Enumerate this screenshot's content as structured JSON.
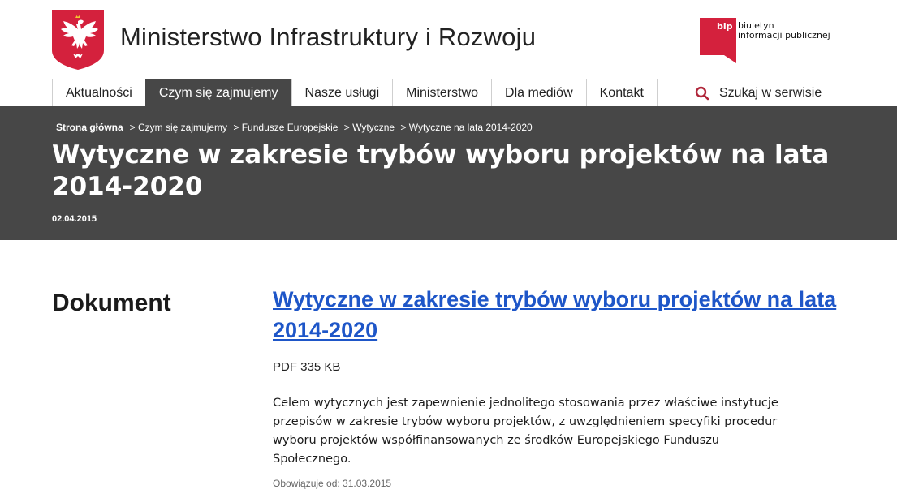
{
  "header": {
    "site_title": "Ministerstwo Infrastruktury i Rozwoju",
    "bip_line1": "biuletyn",
    "bip_line2": "informacji publicznej",
    "bip_logo_text": "bip"
  },
  "nav": {
    "items": [
      {
        "label": "Aktualności",
        "active": false
      },
      {
        "label": "Czym się zajmujemy",
        "active": true
      },
      {
        "label": "Nasze usługi",
        "active": false
      },
      {
        "label": "Ministerstwo",
        "active": false
      },
      {
        "label": "Dla mediów",
        "active": false
      },
      {
        "label": "Kontakt",
        "active": false
      }
    ],
    "search_label": "Szukaj w serwisie"
  },
  "banner": {
    "breadcrumb": {
      "home": "Strona główna",
      "items": [
        "> Czym się zajmujemy",
        "> Fundusze Europejskie",
        "> Wytyczne",
        "> Wytyczne na lata 2014-2020"
      ]
    },
    "title": "Wytyczne w zakresie trybów wyboru projektów na lata 2014-2020",
    "date": "02.04.2015"
  },
  "document": {
    "heading": "Dokument",
    "link_text": "Wytyczne w zakresie trybów wyboru projektów na lata 2014-2020",
    "file_info": "PDF 335 KB",
    "description": "Celem wytycznych jest zapewnienie jednolitego stosowania przez właściwe instytucje przepisów w zakresie trybów wyboru projektów, z uwzględnieniem specyfiki procedur wyboru projektów współfinansowanych ze środków Europejskiego Funduszu Społecznego.",
    "valid_from": "Obowiązuje od: 31.03.2015"
  },
  "colors": {
    "banner_bg": "#474747",
    "link": "#1e56c8",
    "emblem_red": "#d4213d",
    "search_icon": "#b0263a"
  },
  "icons": {
    "emblem": "polish-eagle-emblem-icon",
    "bip": "bip-logo-icon",
    "search": "search-icon"
  }
}
